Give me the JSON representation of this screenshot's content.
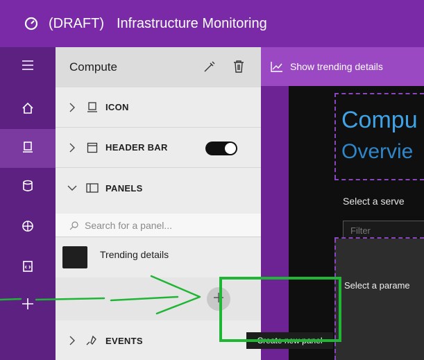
{
  "titlebar": {
    "draft": "(DRAFT)",
    "title": "Infrastructure Monitoring",
    "icon": "gauge-icon"
  },
  "rail": {
    "items": [
      {
        "name": "menu",
        "icon": "hamburger-icon"
      },
      {
        "name": "home",
        "icon": "home-icon"
      },
      {
        "name": "compute",
        "icon": "computer-icon",
        "active": true
      },
      {
        "name": "storage",
        "icon": "database-icon"
      },
      {
        "name": "network",
        "icon": "globe-icon"
      },
      {
        "name": "code",
        "icon": "code-file-icon"
      },
      {
        "name": "add",
        "icon": "plus-icon"
      }
    ]
  },
  "panel": {
    "title": "Compute",
    "sections": {
      "icon": "ICON",
      "header_bar": "HEADER BAR",
      "panels": "PANELS",
      "events": "EVENTS"
    },
    "search_placeholder": "Search for a panel...",
    "panel_items": [
      {
        "label": "Trending details"
      }
    ],
    "header_bar_toggle": "on"
  },
  "trending": {
    "label": "Show trending details"
  },
  "canvas": {
    "title": "Compu",
    "subtitle": "Overvie",
    "select_text": "Select a serve",
    "filter_placeholder": "Filter",
    "param_text": "Select a parame"
  },
  "tooltip": {
    "text": "Create new panel"
  },
  "colors": {
    "titlebar": "#7a2aa6",
    "rail": "#5d2182",
    "accent_bar": "#9a49c2",
    "annotation": "#1fb535",
    "title_blue": "#3fa3e6"
  }
}
